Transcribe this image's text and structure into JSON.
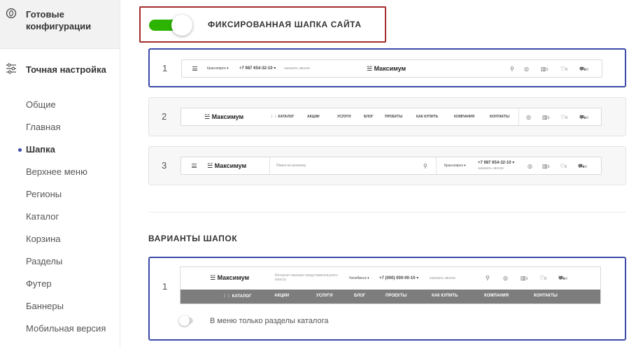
{
  "sidebar": {
    "ready_title": "Готовые конфигурации",
    "fine_title": "Точная настройка",
    "items": [
      {
        "label": "Общие"
      },
      {
        "label": "Главная"
      },
      {
        "label": "Шапка"
      },
      {
        "label": "Верхнее меню"
      },
      {
        "label": "Регионы"
      },
      {
        "label": "Каталог"
      },
      {
        "label": "Корзина"
      },
      {
        "label": "Разделы"
      },
      {
        "label": "Футер"
      },
      {
        "label": "Баннеры"
      },
      {
        "label": "Мобильная версия"
      }
    ]
  },
  "fixed_header": {
    "label": "ФИКСИРОВАННАЯ ШАПКА САЙТА",
    "enabled": true,
    "accent_color": "#2db400",
    "border_color": "#a32b2b"
  },
  "fixed_variants": [
    {
      "num": "1",
      "city": "Красноярск ▾",
      "phone": "+7 987 654-32-10 ▾",
      "callback": "заказать звонок",
      "logo": "Максимум",
      "badges": [
        "0",
        "0",
        "0"
      ]
    },
    {
      "num": "2",
      "logo": "Максимум",
      "catalog": "КАТАЛОГ",
      "nav": [
        "АКЦИИ",
        "УСЛУГИ",
        "БЛОГ",
        "ПРОЕКТЫ",
        "КАК КУПИТЬ",
        "КОМПАНИЯ",
        "КОНТАКТЫ"
      ],
      "badges": [
        "0",
        "0",
        "0"
      ]
    },
    {
      "num": "3",
      "logo": "Максимум",
      "search": "Поиск по каталогу",
      "city": "Красноярск ▾",
      "phone": "+7 987 654-32-10 ▾",
      "callback": "заказать звонок",
      "badges": [
        "0",
        "0",
        "0"
      ]
    }
  ],
  "variants_title": "ВАРИАНТЫ ШАПОК",
  "header_variant": {
    "num": "1",
    "logo": "Максимум",
    "slogan": "Интернет-магазин представительского класса",
    "city": "Челябинск ▾",
    "phone": "+7 (000) 000-00-10 ▾",
    "callback": "заказать звонок",
    "badges": [
      "0",
      "0",
      "0"
    ],
    "nav": [
      "КАТАЛОГ",
      "АКЦИИ",
      "УСЛУГИ",
      "БЛОГ",
      "ПРОЕКТЫ",
      "КАК КУПИТЬ",
      "КОМПАНИЯ",
      "КОНТАКТЫ"
    ],
    "option_label": "В меню только разделы каталога",
    "option_enabled": false
  },
  "accent_color": "#3c4aa8"
}
